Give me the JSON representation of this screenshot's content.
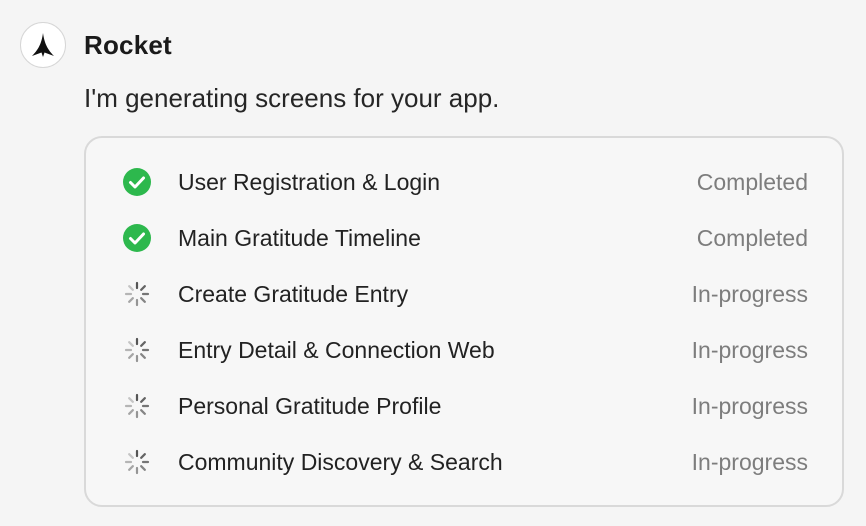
{
  "header": {
    "avatar_icon": "rocket-logo-icon",
    "app_name": "Rocket"
  },
  "message": "I'm generating screens for your app.",
  "colors": {
    "completed": "#2db84d",
    "spinner": "#555555",
    "status_text": "#7d7d7d"
  },
  "tasks": [
    {
      "label": "User Registration & Login",
      "status": "Completed",
      "icon": "check-circle-icon"
    },
    {
      "label": "Main Gratitude Timeline",
      "status": "Completed",
      "icon": "check-circle-icon"
    },
    {
      "label": "Create Gratitude Entry",
      "status": "In-progress",
      "icon": "spinner-icon"
    },
    {
      "label": "Entry Detail & Connection Web",
      "status": "In-progress",
      "icon": "spinner-icon"
    },
    {
      "label": "Personal Gratitude Profile",
      "status": "In-progress",
      "icon": "spinner-icon"
    },
    {
      "label": "Community Discovery & Search",
      "status": "In-progress",
      "icon": "spinner-icon"
    }
  ]
}
